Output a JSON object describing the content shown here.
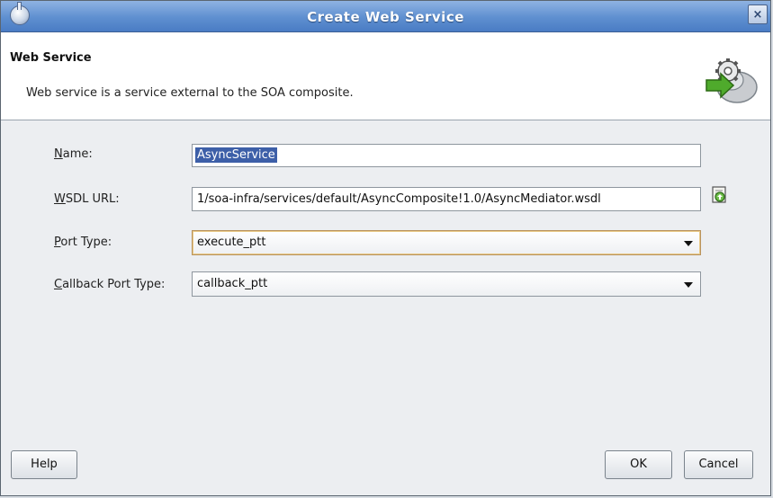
{
  "window": {
    "title": "Create Web Service",
    "close_label": "×"
  },
  "header": {
    "title": "Web Service",
    "description": "Web service is a service external to the SOA composite."
  },
  "form": {
    "name": {
      "label_key": "N",
      "label_rest": "ame:",
      "value": "AsyncService"
    },
    "wsdl_url": {
      "label_key": "W",
      "label_rest": "SDL URL:",
      "value": "1/soa-infra/services/default/AsyncComposite!1.0/AsyncMediator.wsdl"
    },
    "port_type": {
      "label_key": "P",
      "label_rest": "ort Type:",
      "value": "execute_ptt"
    },
    "callback_port_type": {
      "label_key": "C",
      "label_rest": "allback Port Type:",
      "value": "callback_ptt"
    }
  },
  "buttons": {
    "help": "Help",
    "ok": "OK",
    "cancel": "Cancel"
  },
  "icons": {
    "app": "dialog-app-icon",
    "header": "web-service-gear-icon",
    "browse": "find-wsdl-icon"
  },
  "colors": {
    "title_bar": "#5e8fd0",
    "selection": "#3d5fa8",
    "focus_border": "#b9935e"
  }
}
